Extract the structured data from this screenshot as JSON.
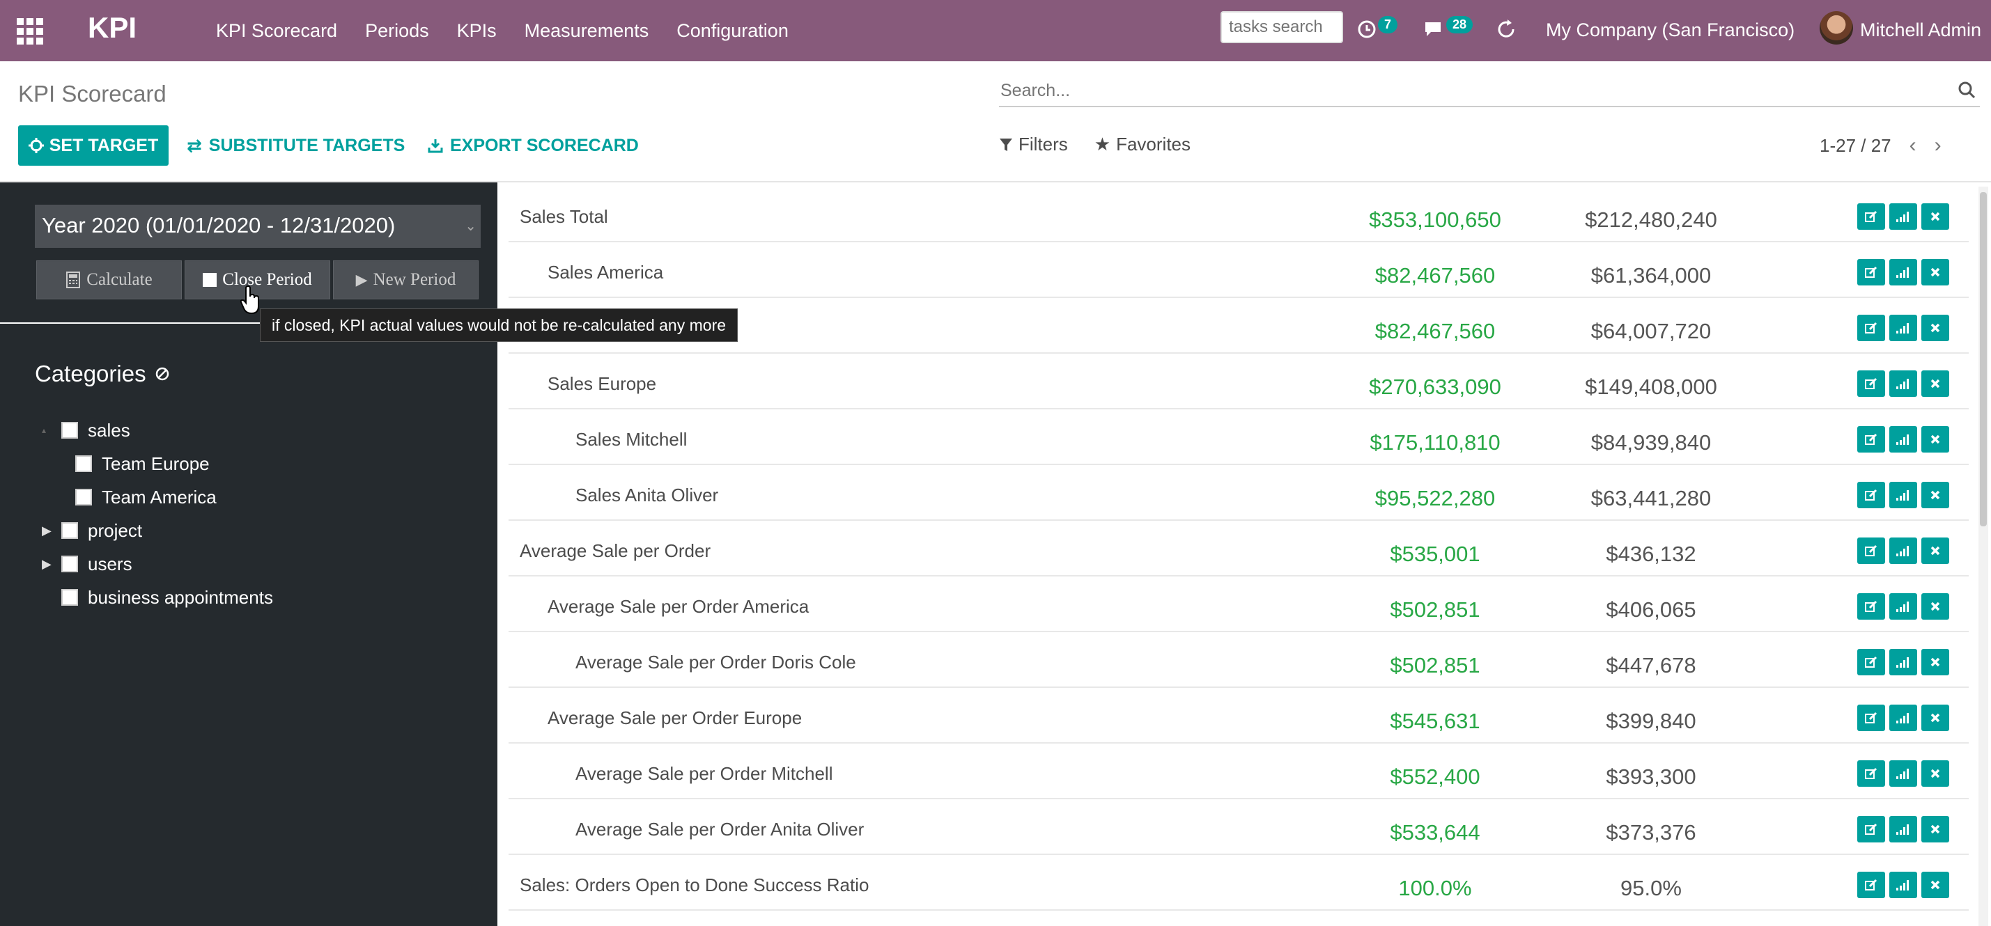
{
  "navbar": {
    "brand": "KPI",
    "menu": [
      "KPI Scorecard",
      "Periods",
      "KPIs",
      "Measurements",
      "Configuration"
    ],
    "tasks_search_placeholder": "tasks search",
    "activity_count": "7",
    "messages_count": "28",
    "company": "My Company (San Francisco)",
    "user": "Mitchell Admin"
  },
  "control_panel": {
    "title": "KPI Scorecard",
    "search_placeholder": "Search...",
    "set_target": "SET TARGET",
    "substitute_targets": "SUBSTITUTE TARGETS",
    "export_scorecard": "EXPORT SCORECARD",
    "filters": "Filters",
    "favorites": "Favorites",
    "pager": "1-27 / 27"
  },
  "sidebar": {
    "period": "Year 2020 (01/01/2020 - 12/31/2020)",
    "calculate": "Calculate",
    "close_period": "Close Period",
    "new_period": "New Period",
    "categories_title": "Categories",
    "tooltip": "if closed, KPI actual values would not be re-calculated any more",
    "tree": [
      {
        "label": "sales",
        "toggle": "▴",
        "level": 0
      },
      {
        "label": "Team Europe",
        "toggle": "",
        "level": 1
      },
      {
        "label": "Team America",
        "toggle": "",
        "level": 1
      },
      {
        "label": "project",
        "toggle": "▸",
        "level": 0
      },
      {
        "label": "users",
        "toggle": "▸",
        "level": 0
      },
      {
        "label": "business appointments",
        "toggle": "",
        "level": 0
      }
    ]
  },
  "rows": [
    {
      "name": "Sales Total",
      "level": 0,
      "actual": "$353,100,650",
      "target": "$212,480,240"
    },
    {
      "name": "Sales America",
      "level": 1,
      "actual": "$82,467,560",
      "target": "$61,364,000"
    },
    {
      "name": "",
      "level": 2,
      "actual": "$82,467,560",
      "target": "$64,007,720"
    },
    {
      "name": "Sales Europe",
      "level": 1,
      "actual": "$270,633,090",
      "target": "$149,408,000"
    },
    {
      "name": "Sales Mitchell",
      "level": 2,
      "actual": "$175,110,810",
      "target": "$84,939,840"
    },
    {
      "name": "Sales Anita Oliver",
      "level": 2,
      "actual": "$95,522,280",
      "target": "$63,441,280"
    },
    {
      "name": "Average Sale per Order",
      "level": 0,
      "actual": "$535,001",
      "target": "$436,132"
    },
    {
      "name": "Average Sale per Order America",
      "level": 1,
      "actual": "$502,851",
      "target": "$406,065"
    },
    {
      "name": "Average Sale per Order Doris Cole",
      "level": 2,
      "actual": "$502,851",
      "target": "$447,678"
    },
    {
      "name": "Average Sale per Order Europe",
      "level": 1,
      "actual": "$545,631",
      "target": "$399,840"
    },
    {
      "name": "Average Sale per Order Mitchell",
      "level": 2,
      "actual": "$552,400",
      "target": "$393,300"
    },
    {
      "name": "Average Sale per Order Anita Oliver",
      "level": 2,
      "actual": "$533,644",
      "target": "$373,376"
    },
    {
      "name": "Sales: Orders Open to Done Success Ratio",
      "level": 0,
      "actual": "100.0%",
      "target": "95.0%"
    }
  ]
}
